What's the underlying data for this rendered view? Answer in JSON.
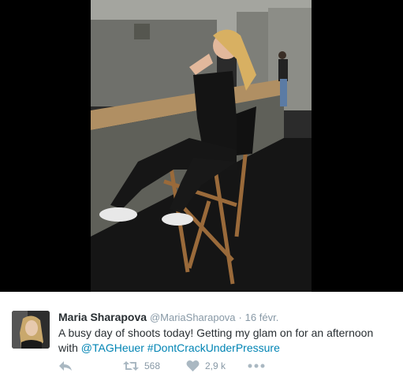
{
  "tweet": {
    "author_name": "Maria Sharapova",
    "handle": "@MariaSharapova",
    "separator": "·",
    "timestamp": "16 févr.",
    "text_part1": "A busy day of shoots today! Getting my glam on for an afternoon with ",
    "mention": "@TAGHeuer",
    "hashtag": "#DontCrackUnderPressure",
    "retweet_count": "568",
    "like_count": "2,9 k"
  },
  "icons": {
    "reply": "reply-icon",
    "retweet": "retweet-icon",
    "like": "heart-icon",
    "more": "more-icon"
  },
  "colors": {
    "link": "#0084b4",
    "name": "#292f33",
    "meta": "#8899a6",
    "icon": "#aab8c2"
  }
}
